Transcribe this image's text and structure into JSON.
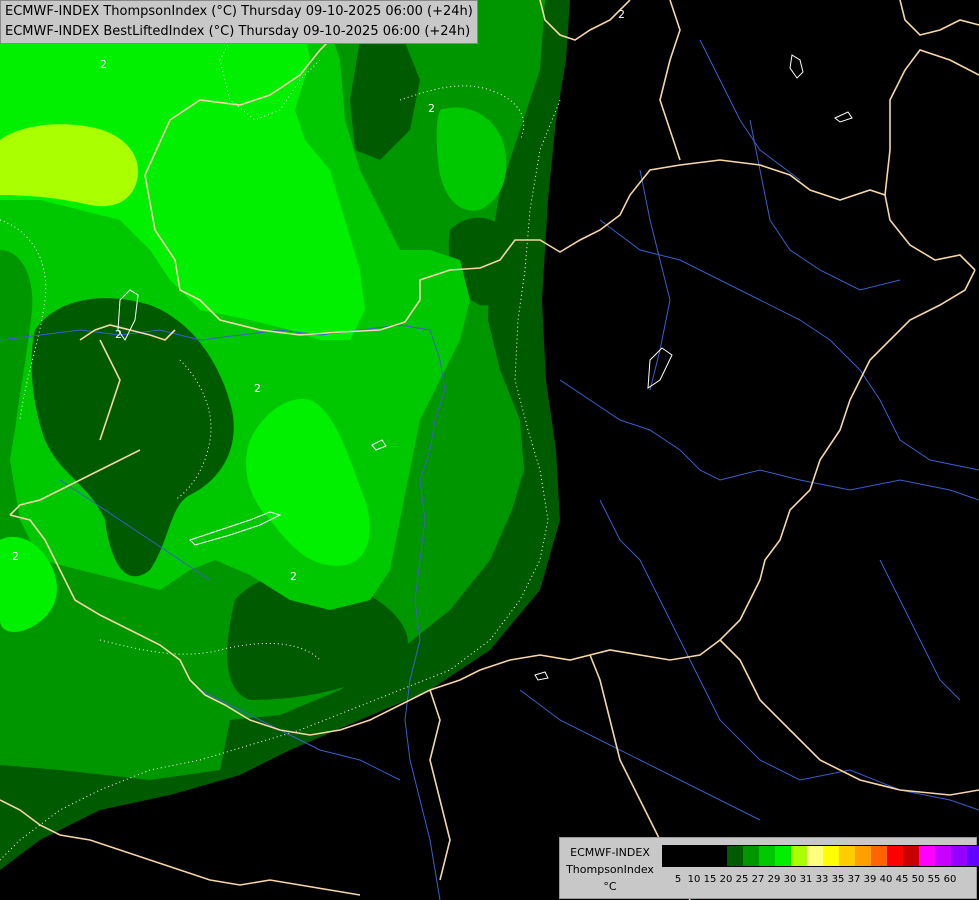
{
  "titles": {
    "line1": "ECMWF-INDEX ThompsonIndex (°C) Thursday 09-10-2025 06:00 (+24h)",
    "line2": "ECMWF-INDEX BestLiftedIndex (°C) Thursday 09-10-2025 06:00 (+24h)"
  },
  "legend": {
    "model": "ECMWF-INDEX",
    "parameter": "ThompsonIndex",
    "unit": "°C",
    "colors": [
      "#000000",
      "#000000",
      "#000000",
      "#000000",
      "#005a00",
      "#009600",
      "#00c800",
      "#00f000",
      "#aaff00",
      "#ffff80",
      "#ffff00",
      "#ffcc00",
      "#ffa000",
      "#ff6400",
      "#ff0000",
      "#c80000",
      "#ff00ff",
      "#c800ff",
      "#9600ff",
      "#6400ff",
      "#0000ff"
    ],
    "ticks": [
      "5",
      "10",
      "15",
      "20",
      "25",
      "27",
      "29",
      "30",
      "31",
      "33",
      "35",
      "37",
      "39",
      "40",
      "45",
      "50",
      "55",
      "60"
    ],
    "tick_after_swatch": [
      0,
      1,
      2,
      3,
      4,
      5,
      6,
      7,
      8,
      9,
      10,
      11,
      12,
      13,
      14,
      15,
      16,
      17
    ]
  },
  "fill_colors": {
    "c20_25": "#005a00",
    "c25_27": "#009600",
    "c27_29": "#00c800",
    "c29_30": "#00f000",
    "c30_31": "#aaff00",
    "background": "#000000"
  },
  "line_colors": {
    "borders": "#f5d7a8",
    "rivers": "#3a5fcd",
    "lifted_index_contours": "#ffffff"
  },
  "contour_labels": [
    "2",
    "2",
    "2",
    "2",
    "2",
    "2",
    "2"
  ]
}
